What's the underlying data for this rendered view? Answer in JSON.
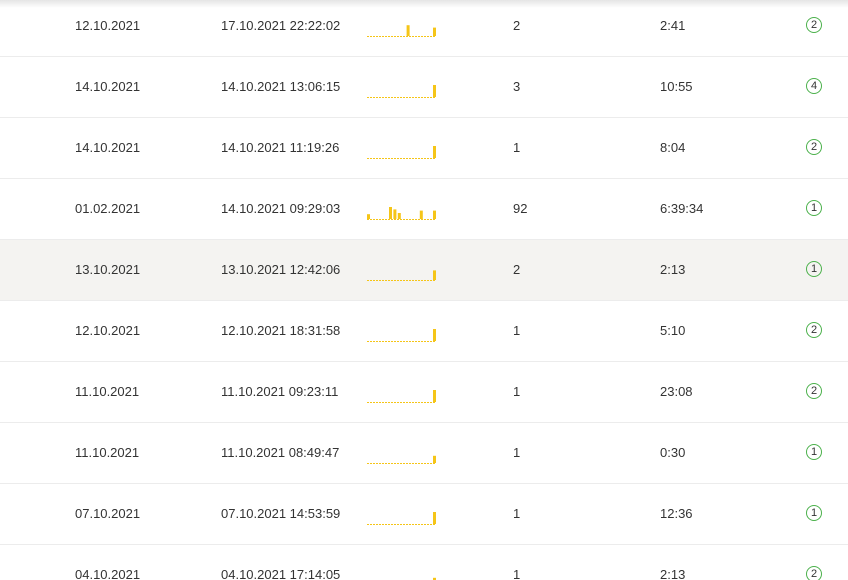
{
  "accent": {
    "spark": "#f5c518",
    "badge_border": "#4cb14c"
  },
  "rows": [
    {
      "first": "12.10.2021",
      "last": "17.10.2021 22:22:02",
      "count": "2",
      "duration": "2:41",
      "badge": "2",
      "spark": [
        0,
        0,
        0,
        0,
        0,
        0,
        0,
        0,
        0,
        0.9,
        0,
        0,
        0,
        0,
        0,
        0.7
      ]
    },
    {
      "first": "14.10.2021",
      "last": "14.10.2021 13:06:15",
      "count": "3",
      "duration": "10:55",
      "badge": "4",
      "spark": [
        0,
        0,
        0,
        0,
        0,
        0,
        0,
        0,
        0,
        0,
        0,
        0,
        0,
        0,
        0,
        1
      ]
    },
    {
      "first": "14.10.2021",
      "last": "14.10.2021 11:19:26",
      "count": "1",
      "duration": "8:04",
      "badge": "2",
      "spark": [
        0,
        0,
        0,
        0,
        0,
        0,
        0,
        0,
        0,
        0,
        0,
        0,
        0,
        0,
        0,
        1
      ]
    },
    {
      "first": "01.02.2021",
      "last": "14.10.2021 09:29:03",
      "count": "92",
      "duration": "6:39:34",
      "badge": "1",
      "spark": [
        0.4,
        0,
        0,
        0,
        0,
        1,
        0.8,
        0.5,
        0,
        0,
        0,
        0,
        0.7,
        0,
        0,
        0.7
      ]
    },
    {
      "first": "13.10.2021",
      "last": "13.10.2021 12:42:06",
      "count": "2",
      "duration": "2:13",
      "badge": "1",
      "spark": [
        0,
        0,
        0,
        0,
        0,
        0,
        0,
        0,
        0,
        0,
        0,
        0,
        0,
        0,
        0,
        0.8
      ]
    },
    {
      "first": "12.10.2021",
      "last": "12.10.2021 18:31:58",
      "count": "1",
      "duration": "5:10",
      "badge": "2",
      "spark": [
        0,
        0,
        0,
        0,
        0,
        0,
        0,
        0,
        0,
        0,
        0,
        0,
        0,
        0,
        0,
        1
      ]
    },
    {
      "first": "11.10.2021",
      "last": "11.10.2021 09:23:11",
      "count": "1",
      "duration": "23:08",
      "badge": "2",
      "spark": [
        0,
        0,
        0,
        0,
        0,
        0,
        0,
        0,
        0,
        0,
        0,
        0,
        0,
        0,
        0,
        1
      ]
    },
    {
      "first": "11.10.2021",
      "last": "11.10.2021 08:49:47",
      "count": "1",
      "duration": "0:30",
      "badge": "1",
      "spark": [
        0,
        0,
        0,
        0,
        0,
        0,
        0,
        0,
        0,
        0,
        0,
        0,
        0,
        0,
        0,
        0.6
      ]
    },
    {
      "first": "07.10.2021",
      "last": "07.10.2021 14:53:59",
      "count": "1",
      "duration": "12:36",
      "badge": "1",
      "spark": [
        0,
        0,
        0,
        0,
        0,
        0,
        0,
        0,
        0,
        0,
        0,
        0,
        0,
        0,
        0,
        1
      ]
    },
    {
      "first": "04.10.2021",
      "last": "04.10.2021 17:14:05",
      "count": "1",
      "duration": "2:13",
      "badge": "2",
      "spark": [
        0,
        0,
        0,
        0,
        0,
        0,
        0,
        0,
        0,
        0,
        0,
        0,
        0,
        0,
        0,
        0.6
      ]
    }
  ],
  "highlighted_row": 4
}
